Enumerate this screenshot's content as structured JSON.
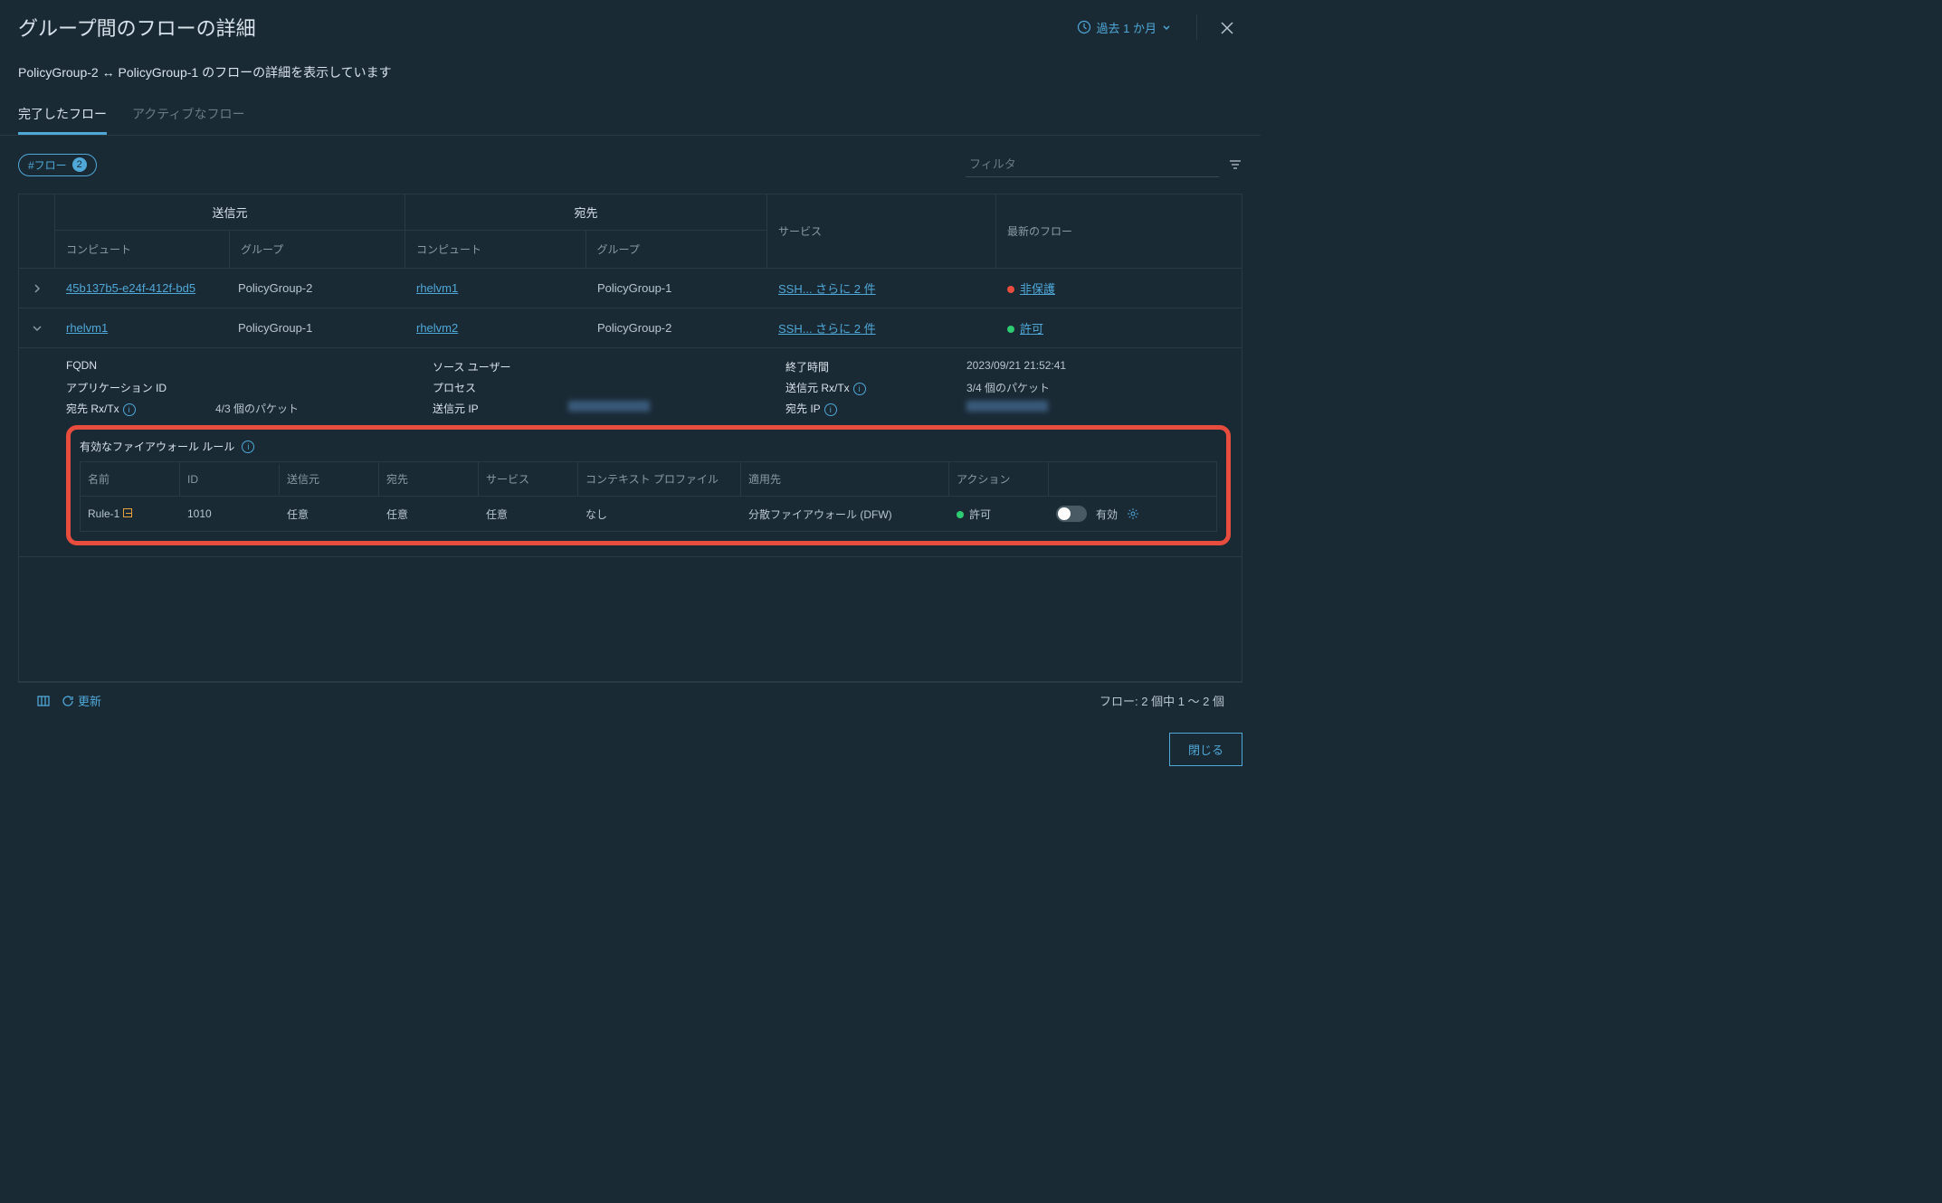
{
  "header": {
    "title": "グループ間のフローの詳細",
    "time_range": "過去 1 か月"
  },
  "subheader": "PolicyGroup-2 ↔ PolicyGroup-1 のフローの詳細を表示しています",
  "tabs": {
    "completed": "完了したフロー",
    "active": "アクティブなフロー"
  },
  "filter": {
    "pill_label": "#フロー",
    "pill_count": "2",
    "placeholder": "フィルタ"
  },
  "table": {
    "headers": {
      "source": "送信元",
      "destination": "宛先",
      "compute": "コンピュート",
      "group": "グループ",
      "service": "サービス",
      "latest_flow": "最新のフロー"
    },
    "rows": [
      {
        "source_compute": "45b137b5-e24f-412f-bd5",
        "source_group": "PolicyGroup-2",
        "dest_compute": "rhelvm1",
        "dest_group": "PolicyGroup-1",
        "service": "SSH... さらに 2 件",
        "status_label": "非保護",
        "status_color": "red"
      },
      {
        "source_compute": "rhelvm1",
        "source_group": "PolicyGroup-1",
        "dest_compute": "rhelvm2",
        "dest_group": "PolicyGroup-2",
        "service": "SSH... さらに 2 件",
        "status_label": "許可",
        "status_color": "green"
      }
    ]
  },
  "details": {
    "fqdn_label": "FQDN",
    "app_id_label": "アプリケーション ID",
    "dest_rxtx_label": "宛先 Rx/Tx",
    "dest_rxtx_value": "4/3 個のパケット",
    "source_user_label": "ソース ユーザー",
    "process_label": "プロセス",
    "source_ip_label": "送信元 IP",
    "end_time_label": "終了時間",
    "end_time_value": "2023/09/21 21:52:41",
    "source_rxtx_label": "送信元 Rx/Tx",
    "source_rxtx_value": "3/4 個のパケット",
    "dest_ip_label": "宛先 IP"
  },
  "firewall": {
    "title": "有効なファイアウォール ルール",
    "headers": {
      "name": "名前",
      "id": "ID",
      "source": "送信元",
      "destination": "宛先",
      "service": "サービス",
      "context_profile": "コンテキスト プロファイル",
      "applied_to": "適用先",
      "action": "アクション"
    },
    "row": {
      "name": "Rule-1",
      "id": "1010",
      "source": "任意",
      "destination": "任意",
      "service": "任意",
      "context_profile": "なし",
      "applied_to": "分散ファイアウォール (DFW)",
      "action": "許可",
      "toggle_label": "有効"
    }
  },
  "footer": {
    "refresh": "更新",
    "count": "フロー: 2 個中 1 ～ 2 個"
  },
  "close_button": "閉じる"
}
